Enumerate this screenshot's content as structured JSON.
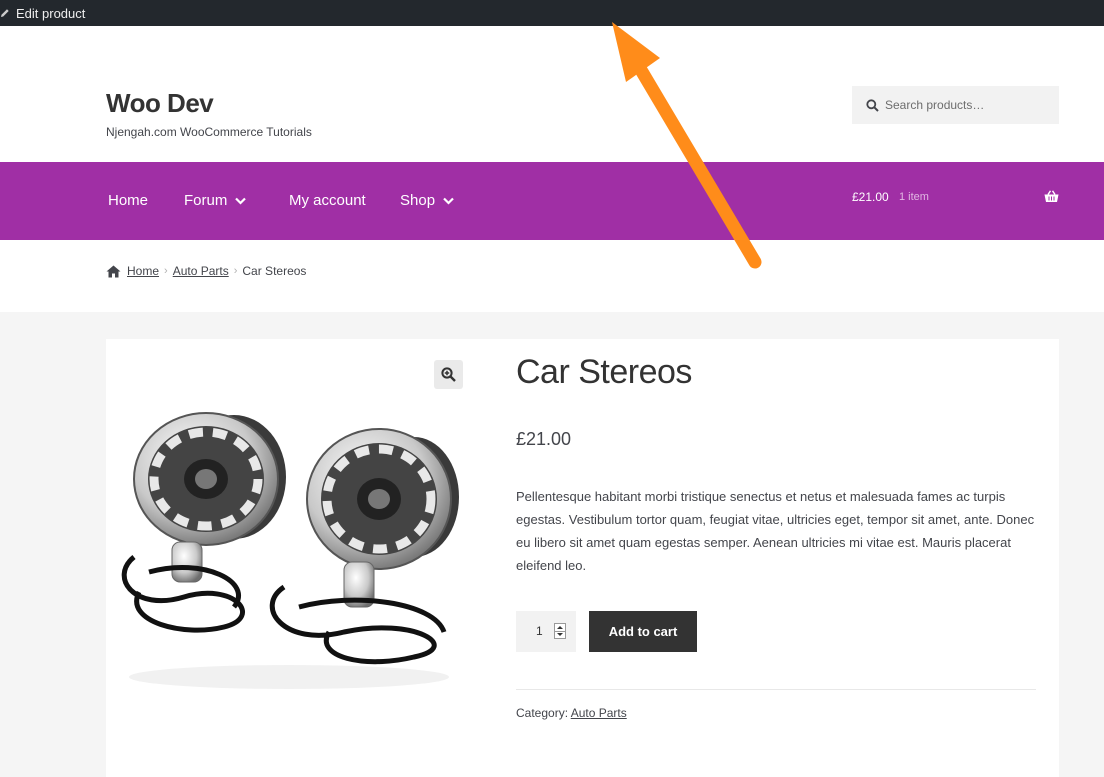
{
  "admin_bar": {
    "edit_label": "Edit product"
  },
  "header": {
    "site_title": "Woo Dev",
    "tagline": "Njengah.com WooCommerce Tutorials",
    "search_placeholder": "Search products…"
  },
  "nav": {
    "items": [
      {
        "label": "Home",
        "has_dropdown": false
      },
      {
        "label": "Forum",
        "has_dropdown": true
      },
      {
        "label": "My account",
        "has_dropdown": false
      },
      {
        "label": "Shop",
        "has_dropdown": true
      }
    ],
    "cart_amount": "£21.00",
    "cart_count": "1 item"
  },
  "breadcrumb": {
    "items": [
      "Home",
      "Auto Parts",
      "Car Stereos"
    ]
  },
  "product": {
    "title": "Car Stereos",
    "price": "£21.00",
    "description": "Pellentesque habitant morbi tristique senectus et netus et malesuada fames ac turpis egestas. Vestibulum tortor quam, feugiat vitae, ultricies eget, tempor sit amet, ante. Donec eu libero sit amet quam egestas semper. Aenean ultricies mi vitae est. Mauris placerat eleifend leo.",
    "quantity": "1",
    "add_to_cart_label": "Add to cart",
    "category_label": "Category:",
    "category_value": "Auto Parts"
  },
  "colors": {
    "nav_background": "#a02fa5",
    "admin_bar": "#23282d",
    "button": "#333333",
    "annotation_arrow": "#ff8c1a"
  },
  "icons": {
    "edit": "pencil-icon",
    "search": "search-icon",
    "cart": "basket-icon",
    "breadcrumb_home": "home-icon",
    "zoom": "zoom-in-icon",
    "dropdown": "chevron-down-icon"
  }
}
